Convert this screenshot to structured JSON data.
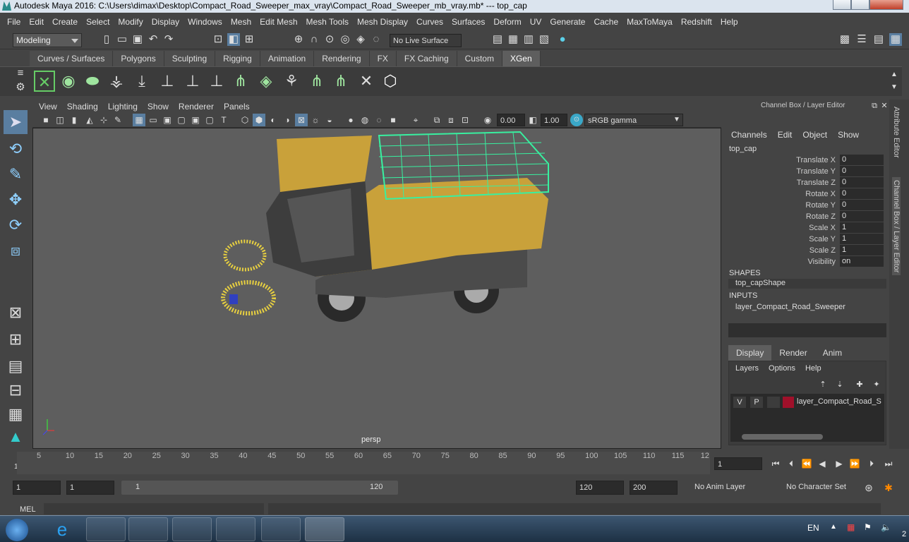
{
  "window": {
    "title": "Autodesk Maya 2016: C:\\Users\\dimax\\Desktop\\Compact_Road_Sweeper_max_vray\\Compact_Road_Sweeper_mb_vray.mb*   ---   top_cap"
  },
  "menu": [
    "File",
    "Edit",
    "Create",
    "Select",
    "Modify",
    "Display",
    "Windows",
    "Mesh",
    "Edit Mesh",
    "Mesh Tools",
    "Mesh Display",
    "Curves",
    "Surfaces",
    "Deform",
    "UV",
    "Generate",
    "Cache",
    "MaxToMaya",
    "Redshift",
    "Help"
  ],
  "status": {
    "mode": "Modeling",
    "live_surface": "No Live Surface"
  },
  "shelf_tabs": [
    "Curves / Surfaces",
    "Polygons",
    "Sculpting",
    "Rigging",
    "Animation",
    "Rendering",
    "FX",
    "FX Caching",
    "Custom",
    "XGen"
  ],
  "shelf_active": "XGen",
  "viewport": {
    "menu": [
      "View",
      "Shading",
      "Lighting",
      "Show",
      "Renderer",
      "Panels"
    ],
    "exposure": "0.00",
    "gamma": "1.00",
    "colorspace": "sRGB gamma",
    "camera": "persp"
  },
  "channel_box": {
    "title": "Channel Box / Layer Editor",
    "menu": [
      "Channels",
      "Edit",
      "Object",
      "Show"
    ],
    "object": "top_cap",
    "channels": [
      {
        "name": "Translate X",
        "value": "0"
      },
      {
        "name": "Translate Y",
        "value": "0"
      },
      {
        "name": "Translate Z",
        "value": "0"
      },
      {
        "name": "Rotate X",
        "value": "0"
      },
      {
        "name": "Rotate Y",
        "value": "0"
      },
      {
        "name": "Rotate Z",
        "value": "0"
      },
      {
        "name": "Scale X",
        "value": "1"
      },
      {
        "name": "Scale Y",
        "value": "1"
      },
      {
        "name": "Scale Z",
        "value": "1"
      },
      {
        "name": "Visibility",
        "value": "on"
      }
    ],
    "shapes_label": "SHAPES",
    "shape": "top_capShape",
    "inputs_label": "INPUTS",
    "input": "layer_Compact_Road_Sweeper"
  },
  "layer_editor": {
    "tabs": [
      "Display",
      "Render",
      "Anim"
    ],
    "menu": [
      "Layers",
      "Options",
      "Help"
    ],
    "layer": {
      "v": "V",
      "p": "P",
      "name": "layer_Compact_Road_Sw",
      "color": "#a0102a"
    }
  },
  "side_tabs": [
    "Attribute Editor",
    "Channel Box / Layer Editor"
  ],
  "timeline": {
    "ticks": [
      "5",
      "10",
      "15",
      "20",
      "25",
      "30",
      "35",
      "40",
      "45",
      "50",
      "55",
      "60",
      "65",
      "70",
      "75",
      "80",
      "85",
      "90",
      "95",
      "100",
      "105",
      "110",
      "115",
      "12"
    ],
    "start_marker": "1",
    "current": "1"
  },
  "range": {
    "start": "1",
    "playback_start": "1",
    "slider_start": "1",
    "slider_end": "120",
    "playback_end": "120",
    "end": "200",
    "anim_layer": "No Anim Layer",
    "char_set": "No Character Set"
  },
  "command": {
    "label": "MEL"
  },
  "taskbar": {
    "lang": "EN",
    "clock": "2"
  }
}
